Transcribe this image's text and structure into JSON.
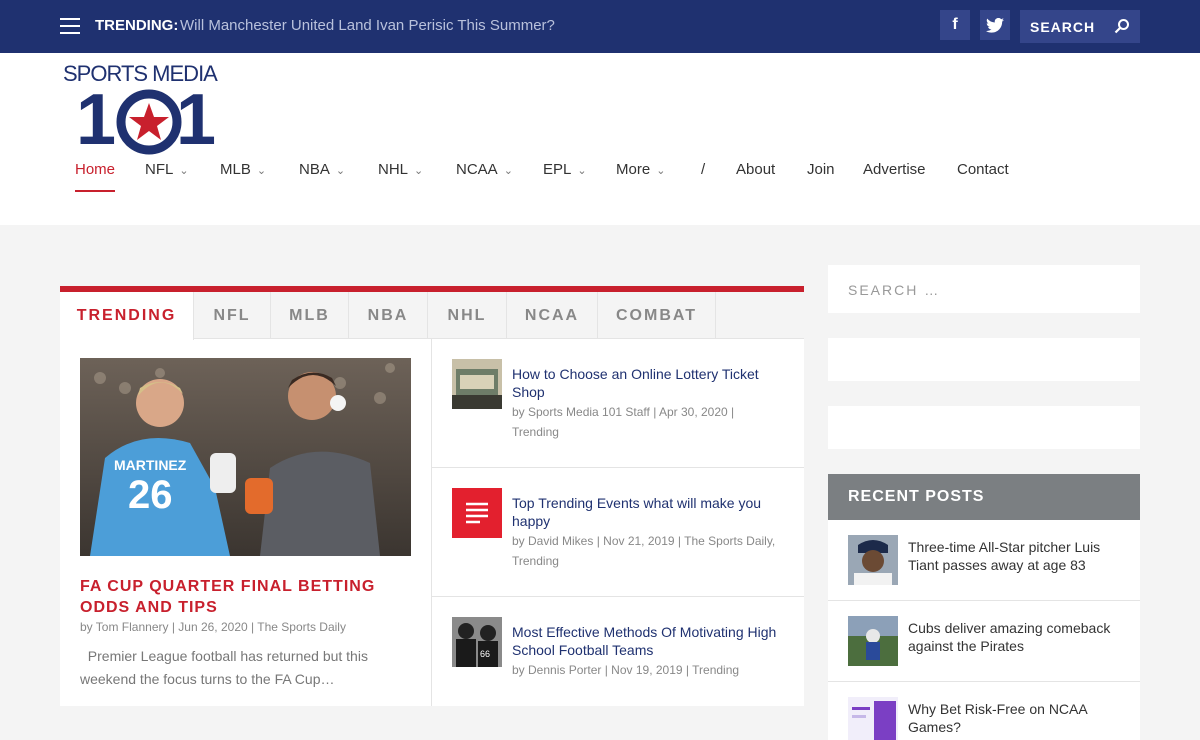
{
  "topbar": {
    "trending_label": "TRENDING:",
    "trending_title": "Will Manchester United Land Ivan Perisic This Summer?",
    "facebook": "f",
    "search_label": "SEARCH"
  },
  "logo": {
    "text": "SPORTS MEDIA",
    "number_left": "1",
    "number_right": "1"
  },
  "nav": [
    {
      "label": "Home"
    },
    {
      "label": "NFL"
    },
    {
      "label": "MLB"
    },
    {
      "label": "NBA"
    },
    {
      "label": "NHL"
    },
    {
      "label": "NCAA"
    },
    {
      "label": "EPL"
    },
    {
      "label": "More"
    },
    {
      "label": "/"
    },
    {
      "label": "About"
    },
    {
      "label": "Join"
    },
    {
      "label": "Advertise"
    },
    {
      "label": "Contact"
    }
  ],
  "tabs": [
    "TRENDING",
    "NFL",
    "MLB",
    "NBA",
    "NHL",
    "NCAA",
    "COMBAT"
  ],
  "feature": {
    "title": "FA CUP QUARTER FINAL BETTING ODDS AND TIPS",
    "author": "by Tom Flannery",
    "date": "Jun 26, 2020",
    "category": "The Sports Daily",
    "excerpt": "Premier League football has returned but this weekend the focus turns to the FA Cup…",
    "jersey_number": "26",
    "jersey_name": "MARTINEZ"
  },
  "posts": [
    {
      "title": "How to Choose an Online Lottery Ticket Shop",
      "author": "by Sports Media 101 Staff",
      "date": "Apr 30, 2020",
      "category": "Trending"
    },
    {
      "title": "Top Trending Events what will make you happy",
      "author": "by David Mikes",
      "date": "Nov 21, 2019",
      "category": "The Sports Daily, Trending"
    },
    {
      "title": "Most Effective Methods Of Motivating High School Football Teams",
      "author": "by Dennis Porter",
      "date": "Nov 19, 2019",
      "category": "Trending"
    }
  ],
  "sidebar": {
    "search_placeholder": "SEARCH …",
    "recent_heading": "RECENT POSTS",
    "recent": [
      {
        "title": "Three-time All-Star pitcher Luis Tiant passes away at age 83"
      },
      {
        "title": "Cubs deliver amazing comeback against the Pirates"
      },
      {
        "title": "Why Bet Risk-Free on NCAA Games?"
      }
    ]
  },
  "colors": {
    "navy": "#1f3170",
    "red": "#c8202d",
    "gray_header": "#7b7f82"
  }
}
